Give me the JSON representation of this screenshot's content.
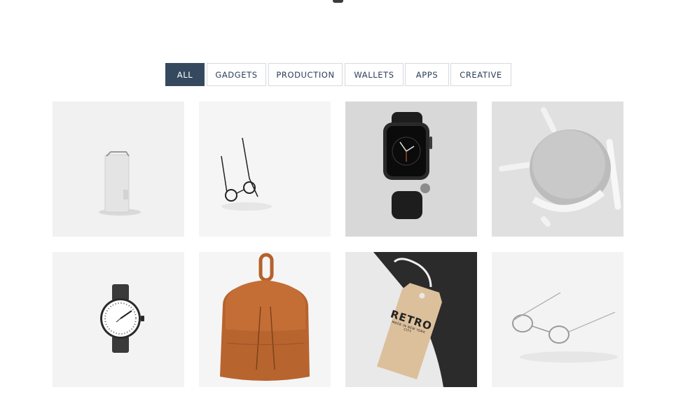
{
  "filters": [
    {
      "label": "ALL",
      "active": true
    },
    {
      "label": "GADGETS",
      "active": false
    },
    {
      "label": "PRODUCTION",
      "active": false
    },
    {
      "label": "WALLETS",
      "active": false
    },
    {
      "label": "APPS",
      "active": false
    },
    {
      "label": "CREATIVE",
      "active": false
    }
  ],
  "tag": {
    "brand_line1": "RETRO",
    "line2": "MADE IN NEW YORK CITY"
  },
  "colors": {
    "active_filter": "#34495e",
    "filter_text": "#2c3e57",
    "border": "#d6d9de"
  }
}
